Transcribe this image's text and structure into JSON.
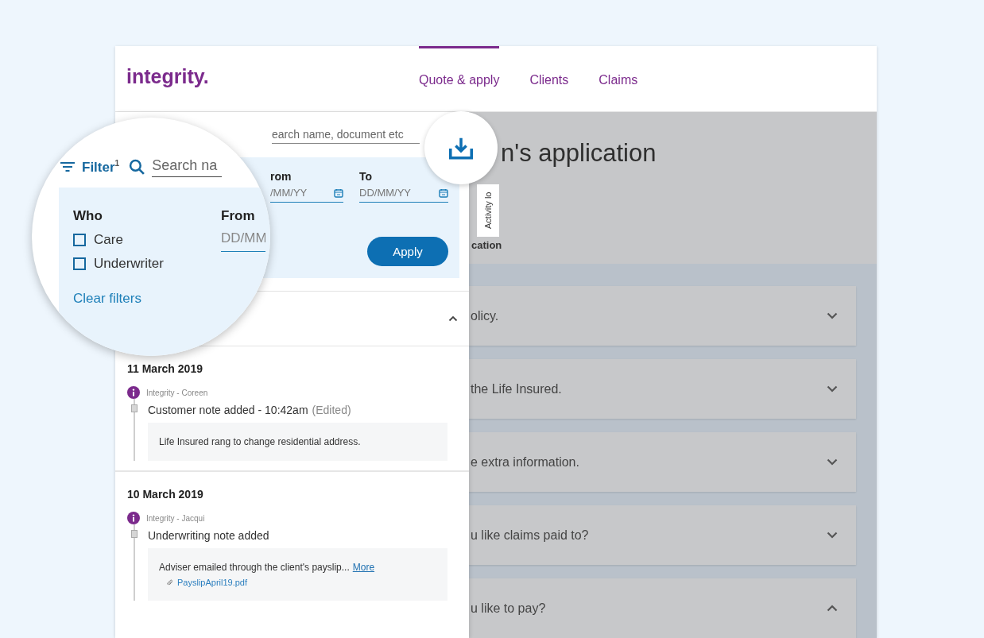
{
  "header": {
    "logo": "integrity.",
    "nav": [
      {
        "label": "Quote & apply",
        "selected": true
      },
      {
        "label": "Clients",
        "selected": false
      },
      {
        "label": "Claims",
        "selected": false
      }
    ]
  },
  "activity_panel": {
    "search": {
      "placeholder": "earch name, document etc"
    },
    "filter": {
      "from_label": "rom",
      "from_placeholder": "/MM/YY",
      "to_label": "To",
      "to_placeholder": "DD/MM/YY",
      "apply": "Apply"
    },
    "section": {
      "expanded": true
    },
    "entries": [
      {
        "date": "11 March 2019",
        "author": "Integrity - Coreen",
        "title": "Customer note added - 10:42am",
        "edited": "(Edited)",
        "note": "Life Insured rang to change residential address."
      },
      {
        "date": "10 March 2019",
        "author": "Integrity - Jacqui",
        "title": "Underwriting note added",
        "note": "Adviser emailed through the client's payslip...",
        "more_link": "More",
        "attachment": "PayslipApril19.pdf"
      }
    ]
  },
  "magnifier": {
    "filter_label": "Filter$^{1}$",
    "search_placeholder": "Search na",
    "who_label": "Who",
    "options": [
      {
        "label": "Care",
        "checked": false
      },
      {
        "label": "Underwriter",
        "checked": false
      }
    ],
    "from_label": "From",
    "from_placeholder": "DD/MM",
    "clear": "Clear filters"
  },
  "activity_tab": "Activity lo",
  "application": {
    "title": "n's application",
    "subtitle": "cation",
    "sections": [
      {
        "label": "olicy.",
        "expanded": false
      },
      {
        "label": "the Life Insured.",
        "expanded": false
      },
      {
        "label": "e extra information.",
        "expanded": false
      },
      {
        "label": "u like claims paid to?",
        "expanded": false
      },
      {
        "label": "u like to pay?",
        "expanded": true
      }
    ]
  }
}
